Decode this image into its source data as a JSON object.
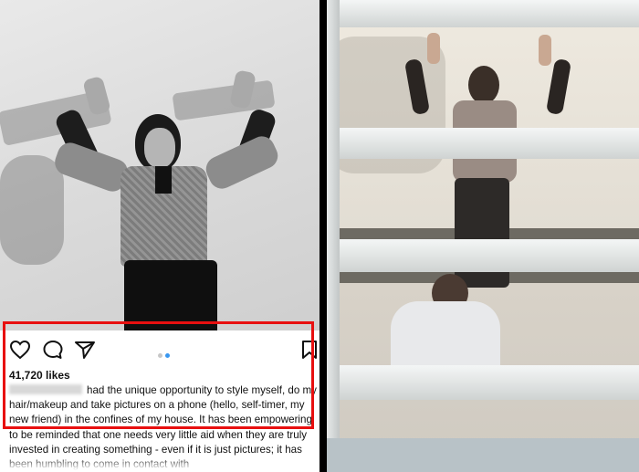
{
  "post": {
    "likes": "41,720 likes",
    "caption": "had the unique opportunity to style myself, do my hair/makeup and take pictures on a phone (hello, self-timer, my new friend) in the confines of my house. It has been empowering to be reminded that one needs very little aid when they are truly invested in creating something - even if it is just pictures; it has been humbling to come in contact with"
  },
  "icons": {
    "like": "heart-icon",
    "comment": "comment-icon",
    "share": "send-icon",
    "save": "bookmark-icon"
  },
  "carousel": {
    "total": 2,
    "active": 2
  },
  "colors": {
    "highlight": "#e81010",
    "active_dot": "#3897f0",
    "inactive_dot": "#c7c7c7"
  }
}
